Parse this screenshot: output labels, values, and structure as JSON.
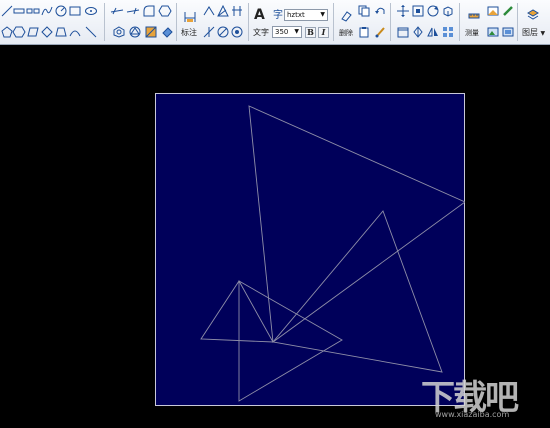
{
  "ribbon": {
    "font_name": "hztxt",
    "text_height": "350",
    "labels": {
      "dimension": "标注",
      "text": "文字",
      "delete": "删除",
      "measure": "测量",
      "layer": "图层",
      "bold": "B",
      "italic": "I",
      "big_a": "A"
    },
    "draw_tools": [
      "line-icon",
      "polyline-icon",
      "spline-icon",
      "curve-icon",
      "circle-icon",
      "rectangle-icon",
      "ellipse-icon",
      "polygon-icon",
      "parallelogram-icon",
      "hexagon-icon",
      "trapezoid-icon",
      "arc-icon",
      "line-tool-icon"
    ],
    "edit_tools": [
      "offset-line-icon",
      "trim-line-icon",
      "extend-icon",
      "rotate-icon",
      "array-icon",
      "mirror-icon",
      "hatch-icon",
      "fill-icon"
    ]
  },
  "colors": {
    "canvas_background": "#000000",
    "drawing_background": "#00005a",
    "border": "#c8c8d8",
    "geometry": "#8e8ea8"
  },
  "watermark": {
    "title": "下载吧",
    "url": "www.xiazaiba.com"
  }
}
